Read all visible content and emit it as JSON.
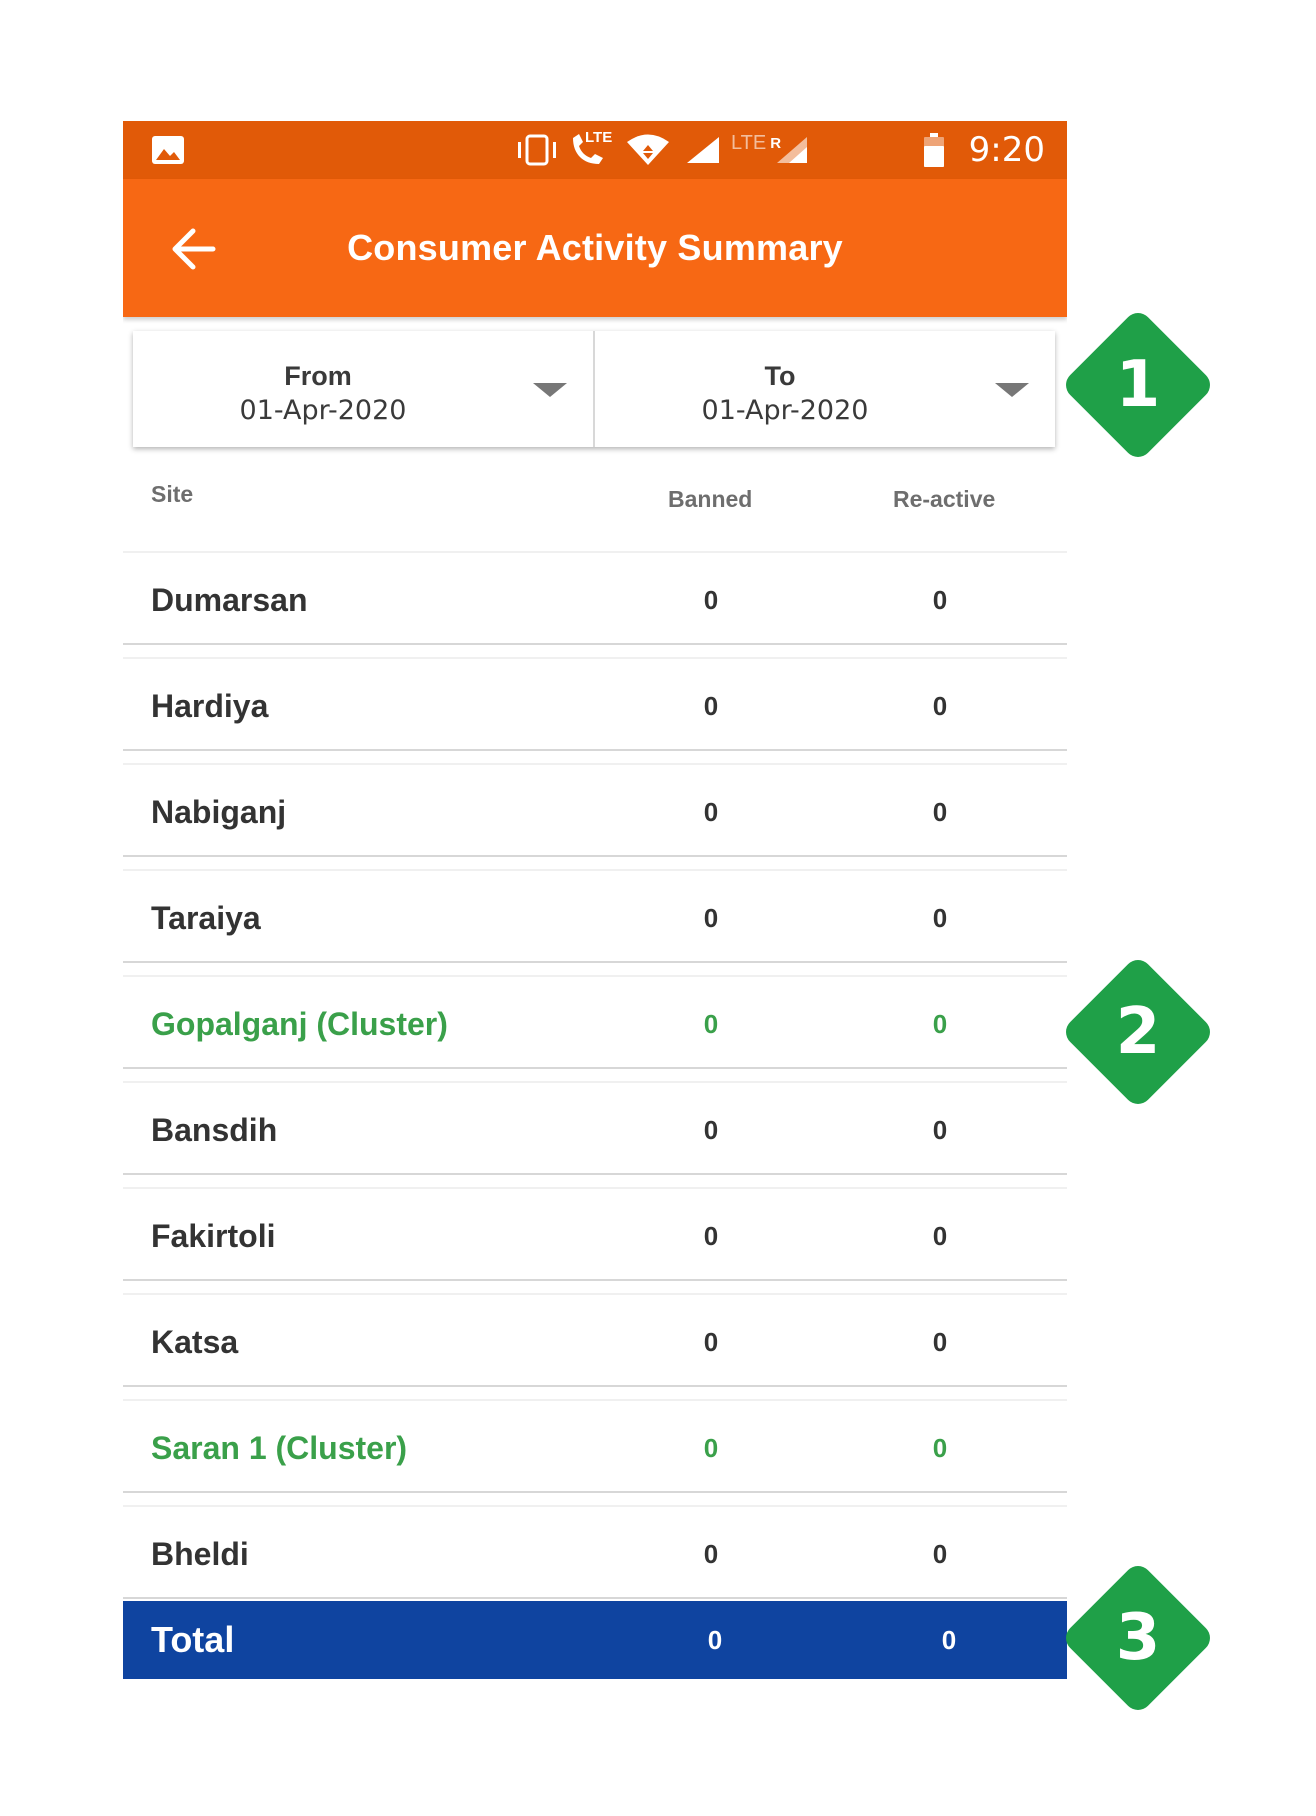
{
  "status_bar": {
    "time": "9:20",
    "icons": [
      "image-icon",
      "vibrate-icon",
      "lte-call-icon",
      "wifi-icon",
      "signal-icon",
      "lte-roaming-signal-icon",
      "battery-icon"
    ],
    "lte_label": "LTE",
    "lte_roaming_label": "LTE",
    "roaming_mark": "R"
  },
  "app_bar": {
    "title": "Consumer Activity Summary",
    "back_icon": "arrow-left-icon"
  },
  "date_filter": {
    "from_label": "From",
    "from_value": "01-Apr-2020",
    "to_label": "To",
    "to_value": "01-Apr-2020"
  },
  "table": {
    "columns": {
      "site": "Site",
      "banned": "Banned",
      "reactive": "Re-active"
    },
    "rows": [
      {
        "site": "Dumarsan",
        "banned": "0",
        "reactive": "0",
        "cluster": false
      },
      {
        "site": "Hardiya",
        "banned": "0",
        "reactive": "0",
        "cluster": false
      },
      {
        "site": "Nabiganj",
        "banned": "0",
        "reactive": "0",
        "cluster": false
      },
      {
        "site": "Taraiya",
        "banned": "0",
        "reactive": "0",
        "cluster": false
      },
      {
        "site": "Gopalganj (Cluster)",
        "banned": "0",
        "reactive": "0",
        "cluster": true
      },
      {
        "site": "Bansdih",
        "banned": "0",
        "reactive": "0",
        "cluster": false
      },
      {
        "site": "Fakirtoli",
        "banned": "0",
        "reactive": "0",
        "cluster": false
      },
      {
        "site": "Katsa",
        "banned": "0",
        "reactive": "0",
        "cluster": false
      },
      {
        "site": "Saran 1 (Cluster)",
        "banned": "0",
        "reactive": "0",
        "cluster": true
      },
      {
        "site": "Bheldi",
        "banned": "0",
        "reactive": "0",
        "cluster": false
      }
    ],
    "total": {
      "label": "Total",
      "banned": "0",
      "reactive": "0"
    }
  },
  "callouts": [
    "1",
    "2",
    "3"
  ],
  "colors": {
    "status_bar": "#e15a08",
    "app_bar": "#f76814",
    "cluster_text": "#3aa04a",
    "total_bar": "#0f44a0",
    "callout": "#1fa048"
  }
}
